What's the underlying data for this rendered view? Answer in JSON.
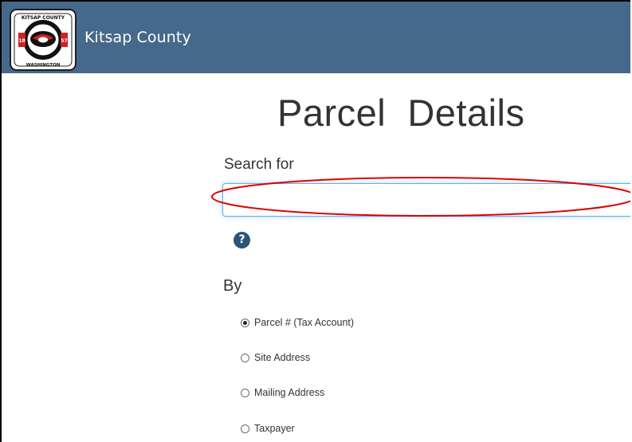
{
  "header": {
    "brand": "Kitsap County",
    "background_color": "#45698a",
    "logo": {
      "top_text": "KITSAP COUNTY",
      "bottom_text": "WASHINGTON",
      "year_left": "18",
      "year_right": "57"
    }
  },
  "main": {
    "title": "Parcel  Details",
    "search_label": "Search for",
    "search_value": "",
    "help_icon": "question-circle-icon",
    "by_label": "By",
    "options": [
      {
        "label": "Parcel # (Tax Account)",
        "selected": true
      },
      {
        "label": "Site Address",
        "selected": false
      },
      {
        "label": "Mailing Address",
        "selected": false
      },
      {
        "label": "Taxpayer",
        "selected": false
      }
    ]
  },
  "annotation": {
    "color": "#e00000",
    "shape": "ellipse"
  }
}
